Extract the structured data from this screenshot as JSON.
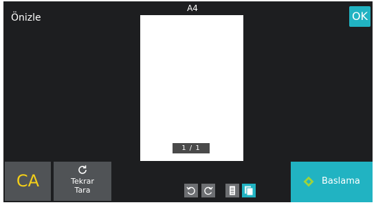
{
  "header": {
    "title": "Önizle",
    "paper_size": "A4",
    "ok_label": "OK"
  },
  "preview": {
    "page_indicator": "1 / 1"
  },
  "footer": {
    "ca_label": "CA",
    "rescan_line1": "Tekrar",
    "rescan_line2": "Tara",
    "start_label": "Baslama"
  },
  "icons": {
    "rescan": "refresh-icon",
    "rotate_left": "rotate-left-icon",
    "rotate_right": "rotate-right-icon",
    "single_page": "single-page-view-icon",
    "multi_page": "multi-page-view-icon",
    "start": "start-diamond-icon"
  },
  "colors": {
    "background": "#1d1e20",
    "accent": "#21b3c2",
    "button_gray": "#505356",
    "ca_text": "#f4cf18",
    "start_icon": "#9fd33a"
  }
}
